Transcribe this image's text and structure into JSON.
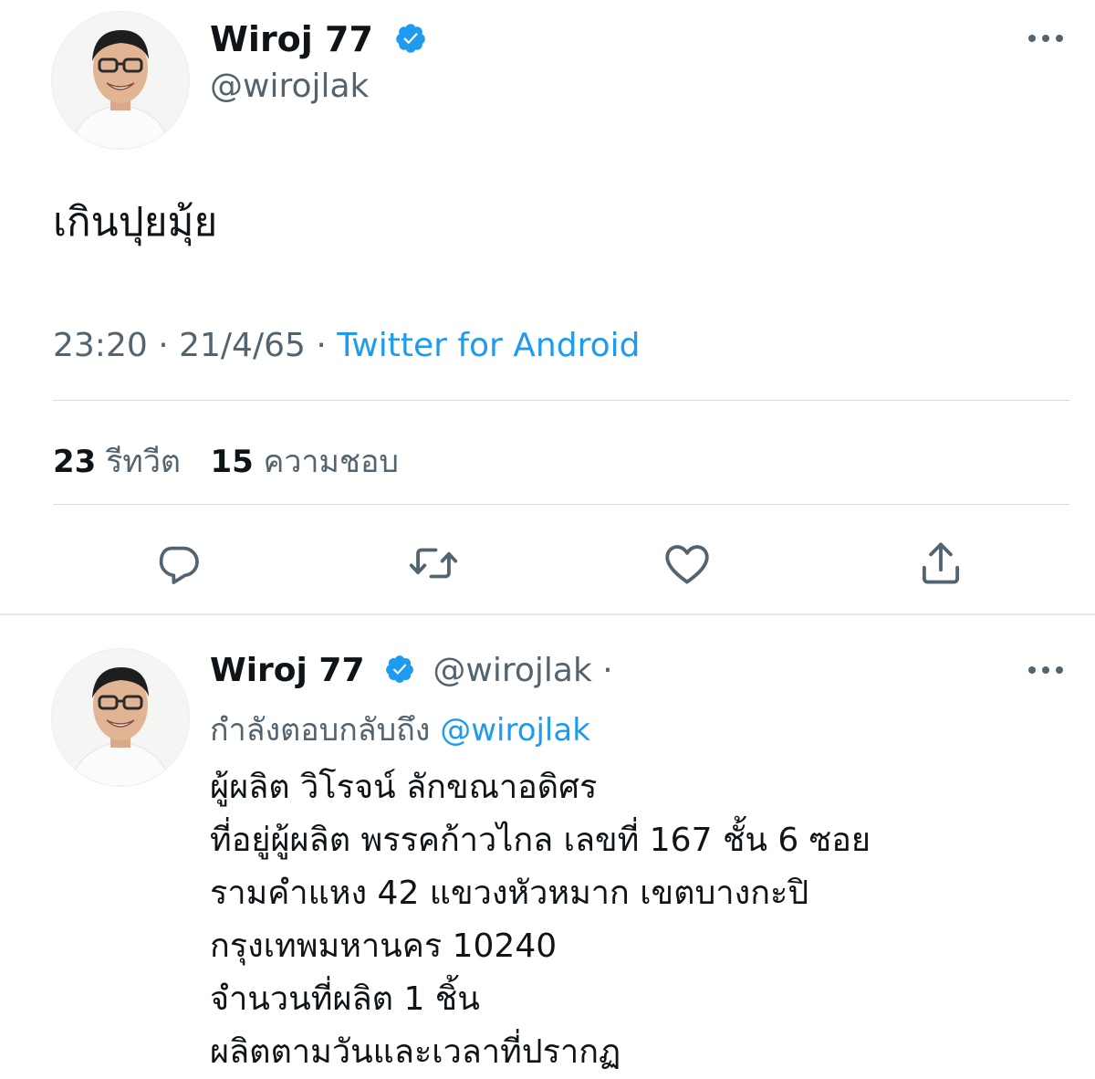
{
  "tweet": {
    "author": {
      "name": "Wiroj 77",
      "handle": "@wirojlak",
      "verified": true
    },
    "text": "เกินปุยมุ้ย",
    "time": "23:20",
    "date": "21/4/65",
    "source": "Twitter for Android",
    "separator": "·",
    "stats": {
      "retweets_count": "23",
      "retweets_label": "รีทวีต",
      "likes_count": "15",
      "likes_label": "ความชอบ"
    },
    "actions": [
      {
        "icon": "reply-icon"
      },
      {
        "icon": "retweet-icon"
      },
      {
        "icon": "like-icon"
      },
      {
        "icon": "share-icon"
      }
    ]
  },
  "reply": {
    "author": {
      "name": "Wiroj 77",
      "handle": "@wirojlak",
      "dot": "·",
      "verified": true
    },
    "replying_to_label": "กำลังตอบกลับถึง",
    "replying_to_handle": "@wirojlak",
    "lines": [
      "ผู้ผลิต วิโรจน์ ลักขณาอดิศร",
      "ที่อยู่ผู้ผลิต พรรคก้าวไกล เลขที่ 167 ชั้น 6 ซอย",
      "รามคำแหง 42 แขวงหัวหมาก เขตบางกะปิ",
      "กรุงเทพมหานคร 10240",
      "จำนวนที่ผลิต 1 ชิ้น",
      "ผลิตตามวันและเวลาที่ปรากฏ"
    ]
  },
  "colors": {
    "accent": "#1d9bf0",
    "text": "#0f1419",
    "secondary": "#536471",
    "divider": "#d5dbe0"
  }
}
